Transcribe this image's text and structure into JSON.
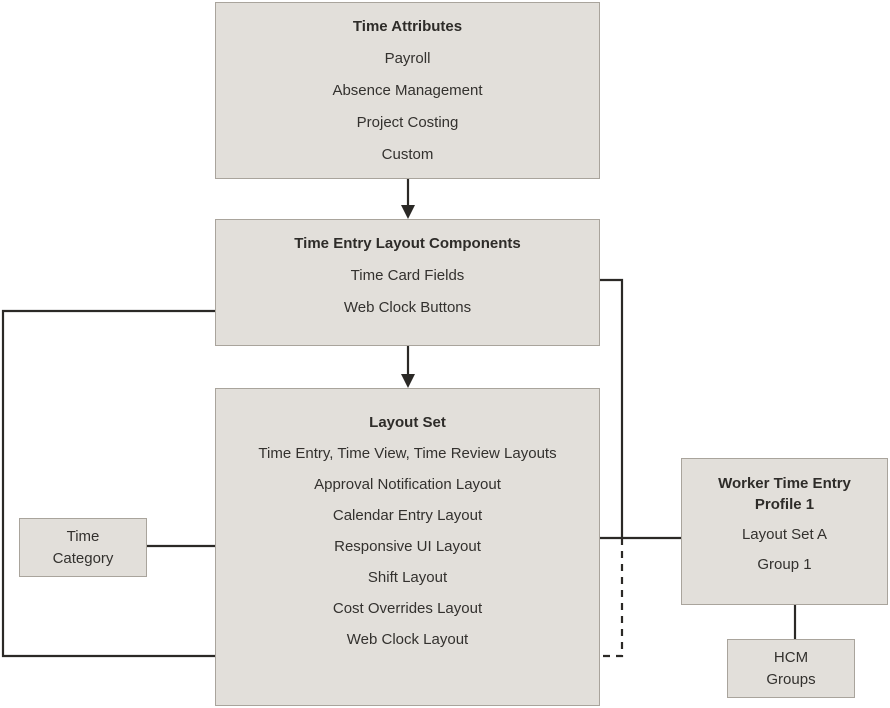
{
  "diagram": {
    "title_present": false,
    "colors": {
      "box_fill": "#e2dfda",
      "box_border": "#a9a49c",
      "text": "#33312e",
      "connector": "#2b2926",
      "background": "#ffffff"
    },
    "boxes": {
      "time_attributes": {
        "title": "Time Attributes",
        "items": [
          "Payroll",
          "Absence Management",
          "Project Costing",
          "Custom"
        ]
      },
      "time_entry_layout_components": {
        "title": "Time Entry Layout Components",
        "items": [
          "Time Card Fields",
          "Web Clock Buttons"
        ]
      },
      "layout_set": {
        "title": "Layout Set",
        "items": [
          "Time Entry, Time View, Time Review Layouts",
          "Approval Notification Layout",
          "Calendar Entry Layout",
          "Responsive UI Layout",
          "Shift Layout",
          "Cost Overrides Layout",
          "Web Clock Layout"
        ]
      },
      "time_category": {
        "line1": "Time",
        "line2": "Category"
      },
      "worker_time_entry_profile": {
        "title_line1": "Worker Time Entry",
        "title_line2": "Profile 1",
        "items": [
          "Layout Set A",
          "Group 1"
        ]
      },
      "hcm_groups": {
        "line1": "HCM",
        "line2": "Groups"
      }
    },
    "connectors": [
      {
        "name": "time-attributes-to-layout-components",
        "style": "solid",
        "arrow": "down"
      },
      {
        "name": "layout-components-to-layout-set",
        "style": "solid",
        "arrow": "down"
      },
      {
        "name": "time-card-fields-to-calendar-entry-layout",
        "style": "solid",
        "arrow": "left"
      },
      {
        "name": "time-card-fields-to-layout-set-a",
        "style": "solid",
        "arrow": "right"
      },
      {
        "name": "web-clock-buttons-to-web-clock-layout",
        "style": "solid",
        "arrow": "right"
      },
      {
        "name": "time-category-to-layout-set",
        "style": "solid",
        "arrow": "right"
      },
      {
        "name": "dashed-to-web-clock-layout",
        "style": "dashed",
        "arrow": "left"
      },
      {
        "name": "hcm-groups-to-worker-profile",
        "style": "solid",
        "arrow": "up"
      }
    ]
  }
}
